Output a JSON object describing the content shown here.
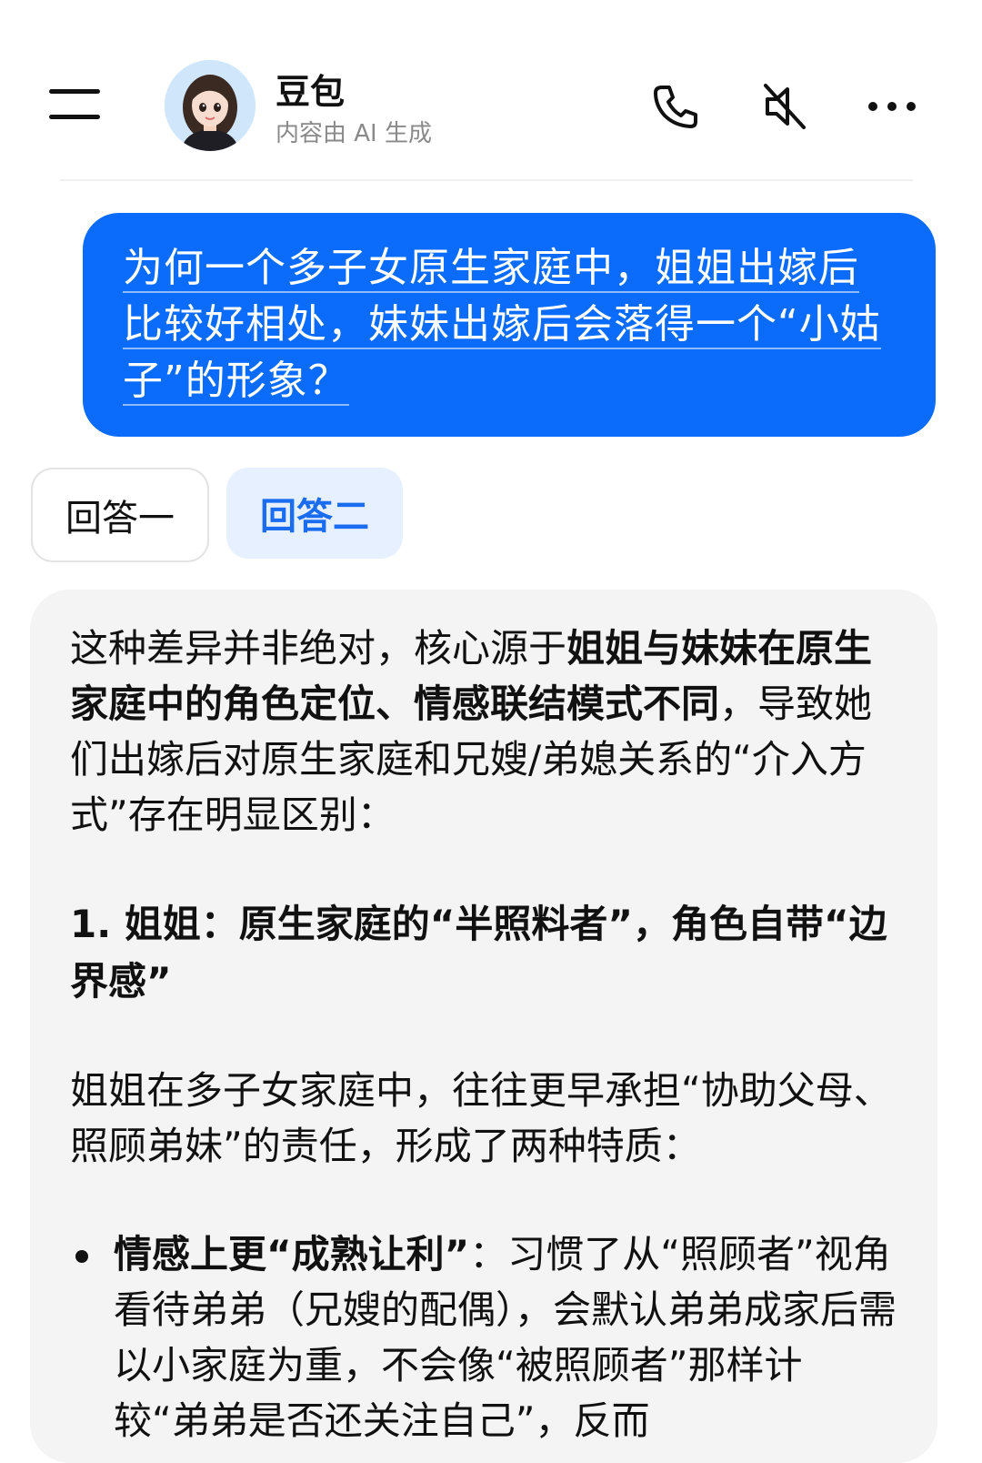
{
  "header": {
    "bot_name": "豆包",
    "bot_subtitle": "内容由 AI 生成",
    "actions": [
      "menu-icon",
      "phone-icon",
      "speaker-muted-icon",
      "more-icon"
    ]
  },
  "user_message": {
    "text": "为何一个多子女原生家庭中，姐姐出嫁后比较好相处，妹妹出嫁后会落得一个“小姑子”的形象？",
    "bubble_color": "#0b6cfb"
  },
  "answer_tabs": {
    "tab_one": "回答一",
    "tab_two": "回答二",
    "selected": "回答二",
    "accent_color": "#1a6cf0"
  },
  "answer": {
    "intro_plain_1": "这种差异并非绝对，核心源于",
    "intro_bold": "姐姐与妹妹在原生家庭中的角色定位、情感联结模式不同",
    "intro_plain_2": "，导致她们出嫁后对原生家庭和兄嫂/弟媳关系的“介入方式”存在明显区别：",
    "section1_heading": "1. 姐姐：原生家庭的“半照料者”，角色自带“边界感”",
    "section1_para": "姐姐在多子女家庭中，往往更早承担“协助父母、照顾弟妹”的责任，形成了两种特质：",
    "bullet1_bold": "情感上更“成熟让利”",
    "bullet1_text": "：习惯了从“照顾者”视角看待弟弟（兄嫂的配偶），会默认弟弟成家后需以小家庭为重，不会像“被照顾者”那样计较“弟弟是否还关注自己”，反而"
  }
}
